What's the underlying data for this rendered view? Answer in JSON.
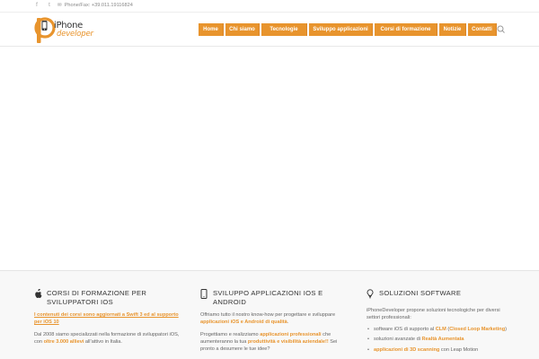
{
  "topbar": {
    "social": [
      {
        "name": "facebook-icon",
        "glyph": "f"
      },
      {
        "name": "twitter-icon",
        "glyph": "t"
      }
    ],
    "phone_label": "Phone/Fax: +39.011.19116824"
  },
  "logo": {
    "line1": "iPhone",
    "line2": "developer",
    "brand_color": "#e8942d"
  },
  "nav": {
    "items": [
      {
        "label": "Home"
      },
      {
        "label": "Chi siamo"
      },
      {
        "label": "Tecnologie"
      },
      {
        "label": "Sviluppo applicazioni"
      },
      {
        "label": "Corsi di formazione"
      },
      {
        "label": "Notizie"
      },
      {
        "label": "Contatti"
      }
    ],
    "accent": "#e8942d"
  },
  "sections": {
    "courses": {
      "title": "CORSI DI FORMAZIONE PER SVILUPPATORI IOS",
      "link_text": "I contenuti dei corsi sono aggiornati a Swift 3 ed al supporto per iOS 10",
      "p2_pre": "Dal 2008 siamo specializzati nella formazione di sviluppatori iOS, con ",
      "p2_highlight": "oltre 3.000 allievi",
      "p2_post": " all’attivo in Italia."
    },
    "dev": {
      "title": "SVILUPPO APPLICAZIONI IOS E ANDROID",
      "p1_pre": "Offriamo tutto il nostro know-how per progettare e sviluppare ",
      "p1_highlight": "applicazioni iOS e Android di qualità",
      "p1_post": ".",
      "p2_pre": "Progettiamo e realizziamo ",
      "p2_highlight1": "applicazioni professionali",
      "p2_mid": " che aumenteranno la tua ",
      "p2_highlight2": "produttività e visibilità aziendale!!",
      "p2_post": "  Sei pronto a desumere le tue idee?"
    },
    "software": {
      "title": "SOLUZIONI SOFTWARE",
      "intro": "iPhoneDeveloper propone soluzioni tecnologiche per diversi settori professionali:",
      "b1_pre": "software iOS di supporto al ",
      "b1_h1": "CLM",
      "b1_mid": " (",
      "b1_h2": "Closed Loop Marketing",
      "b1_post": ")",
      "b2_pre": "soluzioni avanzate di ",
      "b2_h": "Realtà Aumentata",
      "b3_h": "applicazioni di 3D scanning",
      "b3_post": " con Leap Motion"
    }
  }
}
